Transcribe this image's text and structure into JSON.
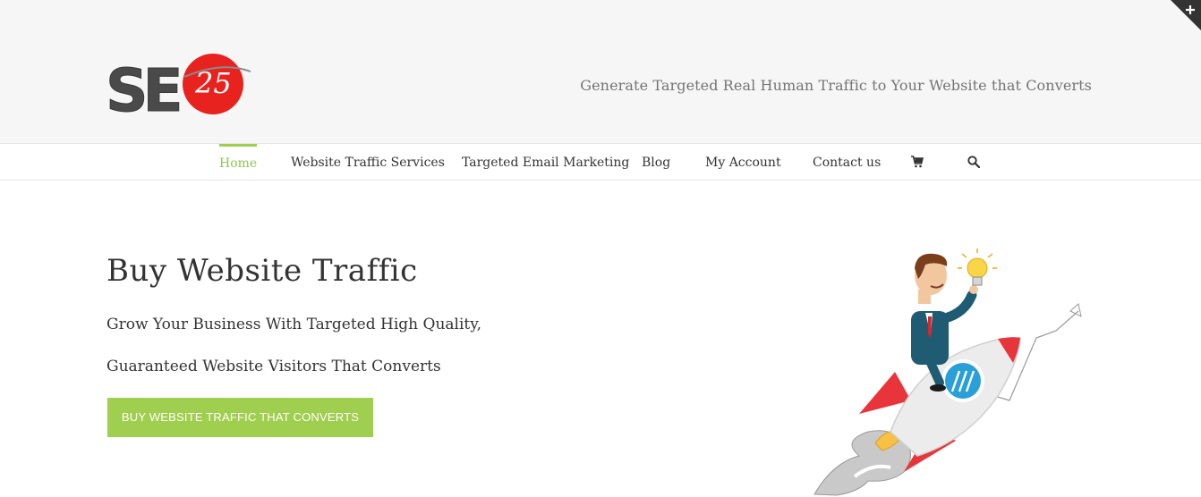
{
  "header": {
    "logo_text": "SE",
    "logo_number": "25",
    "tagline": "Generate Targeted Real Human Traffic to Your Website that Converts"
  },
  "nav": {
    "items": [
      {
        "label": "Home",
        "active": true
      },
      {
        "label": "Website Traffic Services",
        "active": false
      },
      {
        "label": "Targeted Email Marketing",
        "active": false
      },
      {
        "label": "Blog",
        "active": false
      },
      {
        "label": "My Account",
        "active": false
      },
      {
        "label": "Contact us",
        "active": false
      }
    ],
    "cart_icon": "shopping-cart-icon",
    "search_icon": "search-icon"
  },
  "hero": {
    "title": "Buy Website Traffic",
    "line1": "Grow Your Business With Targeted High Quality,",
    "line2": "Guaranteed Website Visitors That Converts",
    "cta_label": "BUY WEBSITE TRAFFIC THAT CONVERTS"
  },
  "colors": {
    "accent": "#a0ce4e",
    "header_bg": "#f6f6f6",
    "logo_red": "#e8231f",
    "logo_gray": "#4a4a4a"
  }
}
